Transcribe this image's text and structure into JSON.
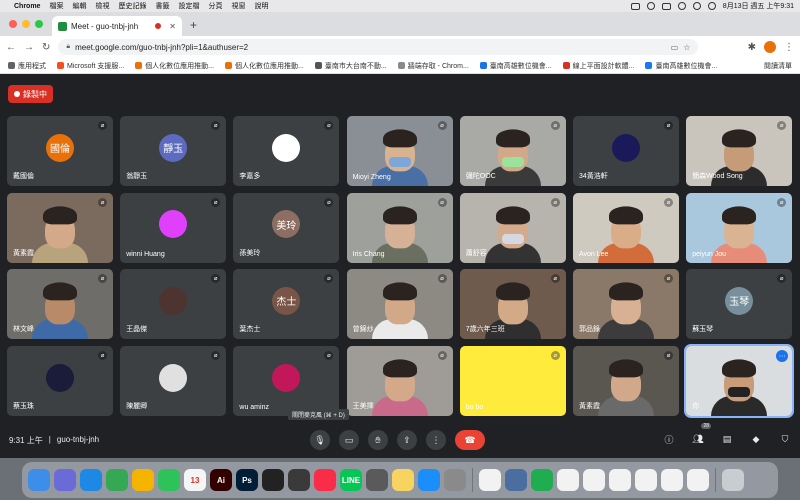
{
  "menubar": {
    "apple": "",
    "app": "Chrome",
    "items": [
      "檔案",
      "編輯",
      "檢視",
      "歷史記錄",
      "書籤",
      "設定檔",
      "分頁",
      "視窗",
      "說明"
    ],
    "datetime": "8月13日 週五 上午9:31"
  },
  "browser": {
    "tab_title": "Meet - guo-tnbj-jnh",
    "url": "meet.google.com/guo-tnbj-jnh?pli=1&authuser=2",
    "bookmarks": [
      "應用程式",
      "Microsoft 支援服...",
      "個人化數位應用推動...",
      "個人化數位應用推動...",
      "臺南市大台南不動...",
      "牆端存取 - Chrom...",
      "臺南高雄數位機會...",
      "線上平面設計軟體...",
      "臺南高雄數位機會..."
    ],
    "reading_list": "閱讀清單"
  },
  "meet": {
    "recording_label": "錄製中",
    "tooltip": "關閉麥克風 (⌘ + D)",
    "time": "9:31 上午",
    "meeting_code": "guo-tnbj-jnh",
    "participant_count": "28",
    "tiles": [
      {
        "name": "戴國倫",
        "initials": "國倫",
        "color": "#e8710a",
        "type": "avatar"
      },
      {
        "name": "翁靜玉",
        "initials": "靜玉",
        "color": "#5c6bc0",
        "type": "avatar"
      },
      {
        "name": "李嘉多",
        "initials": "",
        "color": "#ffffff",
        "type": "avatar"
      },
      {
        "name": "Mioyi Zheng",
        "type": "video",
        "bg": "#8a8f96",
        "skin": "#d8b392",
        "mask": "#7da7d9",
        "shirt": "#4a6fa5"
      },
      {
        "name": "彌陀OOC",
        "type": "video",
        "bg": "#a9a9a6",
        "skin": "#d2a888",
        "mask": "#9be39a",
        "shirt": "#3a3a3a"
      },
      {
        "name": "34黃浩軒",
        "initials": "",
        "color": "#1a1a5a",
        "type": "avatar"
      },
      {
        "name": "簡森Wood Song",
        "type": "video",
        "bg": "#c9c5bd",
        "skin": "#c59b78",
        "mask": "",
        "shirt": "#2c2c2c"
      },
      {
        "name": "黃素霞",
        "type": "video",
        "bg": "#7b6a5e",
        "skin": "#d3a98a",
        "mask": "",
        "shirt": "#b8a47c"
      },
      {
        "name": "winni Huang",
        "initials": "",
        "color": "#e040fb",
        "type": "avatar"
      },
      {
        "name": "孫美玲",
        "initials": "美玲",
        "color": "#8d6e63",
        "type": "avatar"
      },
      {
        "name": "Iris Chang",
        "type": "video",
        "bg": "#9ea09c",
        "skin": "#d6b196",
        "mask": "",
        "shirt": "#6b6f62"
      },
      {
        "name": "蕭舒容",
        "type": "video",
        "bg": "#b7b3ad",
        "skin": "#d3aa8b",
        "mask": "#d5d8df",
        "shirt": "#333333"
      },
      {
        "name": "Avon Lee",
        "type": "video",
        "bg": "#cfcac0",
        "skin": "#d8ad88",
        "mask": "",
        "shirt": "#d26c3a"
      },
      {
        "name": "peiyun Jou",
        "type": "video",
        "bg": "#a9c8dd",
        "skin": "#dab393",
        "mask": "",
        "shirt": "#e88c7a"
      },
      {
        "name": "林文峰",
        "type": "video",
        "bg": "#6f6d6a",
        "skin": "#b88a68",
        "mask": "",
        "shirt": "#3f6aa8"
      },
      {
        "name": "王晶傑",
        "initials": "",
        "color": "#4e342e",
        "type": "avatar"
      },
      {
        "name": "葉杰士",
        "initials": "杰士",
        "color": "#795548",
        "type": "avatar"
      },
      {
        "name": "曾錦炒",
        "type": "video",
        "bg": "#8d8a84",
        "skin": "#d1a989",
        "mask": "",
        "shirt": "#eaeaea"
      },
      {
        "name": "7歲六年三班",
        "type": "video",
        "bg": "#6e5b4d",
        "skin": "#d2aa88",
        "mask": "",
        "shirt": "#2f2f2f"
      },
      {
        "name": "郭品錄",
        "type": "video",
        "bg": "#8a7968",
        "skin": "#d8b093",
        "mask": "",
        "shirt": "#3c3c3c"
      },
      {
        "name": "蘇玉琴",
        "initials": "玉琴",
        "color": "#78909c",
        "type": "avatar"
      },
      {
        "name": "蔡玉珠",
        "initials": "",
        "color": "#1b1b3a",
        "type": "avatar"
      },
      {
        "name": "陳麗卿",
        "initials": "",
        "color": "#e0e0e0",
        "type": "avatar"
      },
      {
        "name": "wu aminz",
        "initials": "",
        "color": "#c2185b",
        "type": "avatar"
      },
      {
        "name": "王美擇",
        "type": "video",
        "bg": "#9f9c97",
        "skin": "#d3a98a",
        "mask": "",
        "shirt": "#c96a8a"
      },
      {
        "name": "bo bo",
        "type": "yellow",
        "bg": "#ffeb3b"
      },
      {
        "name": "黃素霞",
        "type": "video",
        "bg": "#5a5751",
        "skin": "#d1a88a",
        "mask": "",
        "shirt": "#6a6a6a"
      },
      {
        "name": "你",
        "type": "video",
        "bg": "#d9dde0",
        "skin": "#c99b78",
        "mask": "#222222",
        "shirt": "#2a2a2a",
        "active": true
      }
    ]
  },
  "dock": {
    "icons": [
      {
        "name": "finder",
        "label": "",
        "color": "#3d8ee8"
      },
      {
        "name": "launchpad",
        "label": "",
        "color": "#6b6bd8"
      },
      {
        "name": "safari",
        "label": "",
        "color": "#1e88e5"
      },
      {
        "name": "chrome",
        "label": "",
        "color": "#34a853"
      },
      {
        "name": "photos",
        "label": "",
        "color": "#f4b400"
      },
      {
        "name": "facetime",
        "label": "",
        "color": "#2ec25a"
      },
      {
        "name": "calendar",
        "label": "13",
        "color": "#f5f5f5"
      },
      {
        "name": "illustrator",
        "label": "Ai",
        "color": "#330000"
      },
      {
        "name": "photoshop",
        "label": "Ps",
        "color": "#001e36"
      },
      {
        "name": "final-cut",
        "label": "",
        "color": "#222222"
      },
      {
        "name": "quicktime",
        "label": "",
        "color": "#3a3a3a"
      },
      {
        "name": "music",
        "label": "",
        "color": "#fa2d48"
      },
      {
        "name": "line",
        "label": "LINE",
        "color": "#06c755"
      },
      {
        "name": "calculator",
        "label": "",
        "color": "#5a5a5a"
      },
      {
        "name": "notes",
        "label": "",
        "color": "#f7d35f"
      },
      {
        "name": "app-store",
        "label": "",
        "color": "#1c8ef9"
      },
      {
        "name": "system-preferences",
        "label": "",
        "color": "#8a8a8a"
      },
      {
        "name": "document-1",
        "label": "",
        "color": "#f2f2f2"
      },
      {
        "name": "monitor",
        "label": "",
        "color": "#4a6ea0"
      },
      {
        "name": "numbers",
        "label": "",
        "color": "#1fad4f"
      },
      {
        "name": "document-2",
        "label": "",
        "color": "#f2f2f2"
      },
      {
        "name": "document-3",
        "label": "",
        "color": "#f2f2f2"
      },
      {
        "name": "document-4",
        "label": "",
        "color": "#f2f2f2"
      },
      {
        "name": "document-5",
        "label": "",
        "color": "#f2f2f2"
      },
      {
        "name": "document-6",
        "label": "",
        "color": "#f2f2f2"
      },
      {
        "name": "document-7",
        "label": "",
        "color": "#f2f2f2"
      },
      {
        "name": "trash",
        "label": "",
        "color": "#c9ccd1"
      }
    ]
  }
}
